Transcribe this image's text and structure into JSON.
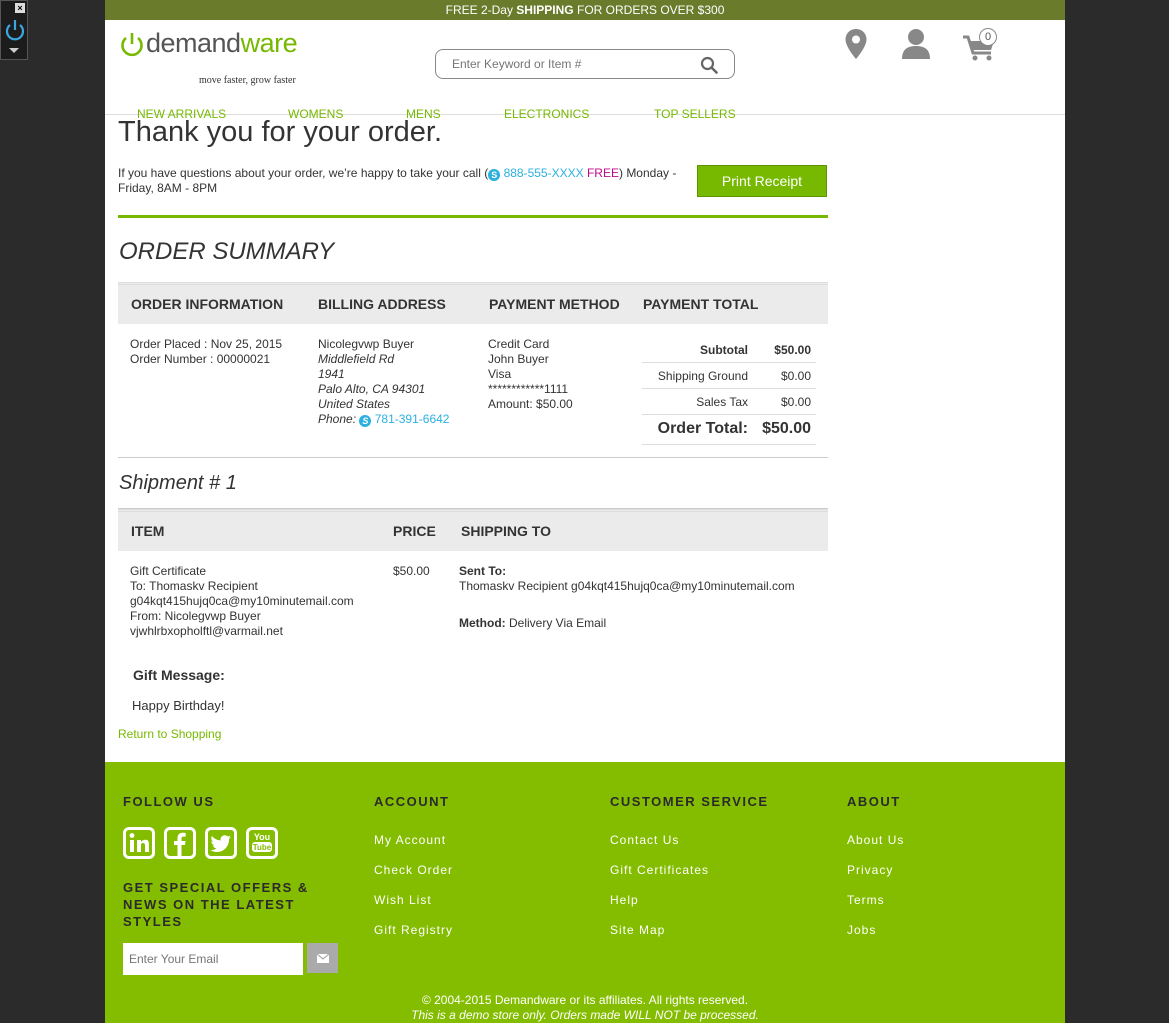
{
  "promo": {
    "prefix": "FREE 2-Day ",
    "strong": "SHIPPING",
    "suffix": " FOR ORDERS OVER $300"
  },
  "brand": {
    "name_part1": "demand",
    "name_part2": "ware",
    "tagline": "move faster, grow faster"
  },
  "search": {
    "placeholder": "Enter Keyword or Item #"
  },
  "cart": {
    "count": "0"
  },
  "nav": {
    "items": [
      "NEW ARRIVALS",
      "WOMENS",
      "MENS",
      "ELECTRONICS",
      "TOP SELLERS"
    ]
  },
  "confirmation": {
    "title": "Thank you for your order.",
    "questions_prefix": "If you have questions about your order, we’re happy to take your call (",
    "phone": "888-555-XXXX",
    "free": "FREE",
    "questions_suffix": ") Monday - Friday, 8AM - 8PM",
    "print_label": "Print Receipt"
  },
  "order_summary": {
    "title": "ORDER SUMMARY",
    "headers": [
      "ORDER INFORMATION",
      "BILLING ADDRESS",
      "PAYMENT METHOD",
      "PAYMENT TOTAL"
    ],
    "order_info": {
      "placed": "Order Placed : Nov 25, 2015",
      "number": "Order Number : 00000021"
    },
    "billing": {
      "name": "Nicolegvwp Buyer",
      "address1": "Middlefield Rd",
      "address2": "1941",
      "city": "Palo Alto, CA 94301",
      "country": "United States",
      "phone_label": "Phone:",
      "phone": "781-391-6642"
    },
    "payment": {
      "type": "Credit Card",
      "name": "John Buyer",
      "card": "Visa",
      "number": "************1111",
      "amount": "Amount: $50.00"
    },
    "totals": {
      "subtotal_label": "Subtotal",
      "subtotal": "$50.00",
      "shipping_label": "Shipping Ground",
      "shipping": "$0.00",
      "tax_label": "Sales Tax",
      "tax": "$0.00",
      "total_label": "Order Total:",
      "total": "$50.00"
    }
  },
  "shipment": {
    "title": "Shipment # 1",
    "headers": [
      "ITEM",
      "PRICE",
      "SHIPPING TO"
    ],
    "item": {
      "name": "Gift Certificate",
      "to": "To: Thomaskv Recipient",
      "to_email": "g04kqt415hujq0ca@my10minutemail.com",
      "from": "From: Nicolegvwp Buyer",
      "from_email": "vjwhlrbxopholftl@varmail.net"
    },
    "price": "$50.00",
    "sent_to_label": "Sent To:",
    "sent_to": "Thomaskv Recipient g04kqt415hujq0ca@my10minutemail.com",
    "method_label": "Method:",
    "method": " Delivery Via Email",
    "gift_message_label": "Gift Message:",
    "gift_message": "Happy Birthday!",
    "return_link": "Return to Shopping"
  },
  "footer": {
    "follow_title": "FOLLOW US",
    "offers": "GET SPECIAL OFFERS & NEWS ON THE LATEST STYLES",
    "email_placeholder": "Enter Your Email",
    "account": {
      "title": "ACCOUNT",
      "links": [
        "My Account",
        "Check Order",
        "Wish List",
        "Gift Registry"
      ]
    },
    "service": {
      "title": "CUSTOMER SERVICE",
      "links": [
        "Contact Us",
        "Gift Certificates",
        "Help",
        "Site Map"
      ]
    },
    "about": {
      "title": "ABOUT",
      "links": [
        "About Us",
        "Privacy",
        "Terms",
        "Jobs"
      ]
    },
    "copyright": "© 2004-2015 Demandware or its affiliates. All rights reserved.",
    "disclaimer": "This is a demo store only. Orders made WILL NOT be processed."
  },
  "colors": {
    "brand_green": "#76b900",
    "footer_green": "#84bd00",
    "promo_bar": "#6b7b2c",
    "link_blue": "#2bb0e0",
    "free_magenta": "#c00a8a"
  },
  "icons": [
    "power-icon",
    "search-icon",
    "location-pin-icon",
    "user-icon",
    "cart-icon",
    "skype-icon",
    "linkedin-icon",
    "facebook-icon",
    "twitter-icon",
    "youtube-icon",
    "envelope-icon"
  ]
}
